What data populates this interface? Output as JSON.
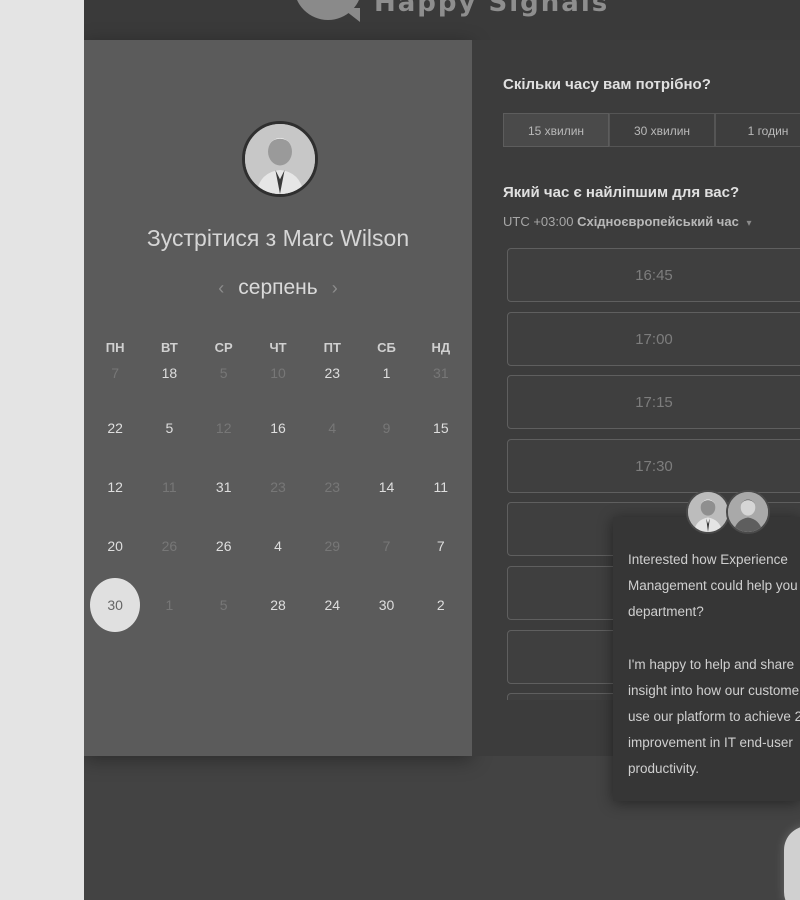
{
  "brand": {
    "wordmark": "Happy Signals"
  },
  "left": {
    "title": "Зустрітися з Marc Wilson",
    "month": "серпень",
    "prev_label": "‹",
    "next_label": "›",
    "weekdays": [
      "ПН",
      "ВТ",
      "СР",
      "ЧТ",
      "ПТ",
      "СБ",
      "НД"
    ],
    "weeks": [
      [
        "7",
        "18",
        "5",
        "10",
        "23",
        "1",
        "31"
      ],
      [
        "22",
        "5",
        "12",
        "16",
        "4",
        "9",
        "15"
      ],
      [
        "12",
        "11",
        "31",
        "23",
        "23",
        "14",
        "11"
      ],
      [
        "20",
        "26",
        "26",
        "4",
        "29",
        "7",
        "7"
      ],
      [
        "30",
        "1",
        "5",
        "28",
        "24",
        "30",
        "2"
      ]
    ]
  },
  "right": {
    "duration_question": "Скільки часу вам потрібно?",
    "durations": [
      "15 хвилин",
      "30 хвилин",
      "1 годин"
    ],
    "time_question": "Який час є найліпшим для вас?",
    "tz_offset": "UTC +03:00",
    "tz_name": "Східноєвропейський час",
    "tz_caret": "▾",
    "slots": [
      "16:45",
      "17:00",
      "17:15",
      "17:30",
      "",
      "",
      "",
      ""
    ]
  },
  "popup": {
    "line1": "Interested how Experience",
    "line2": "Management could help you",
    "line3": "department?",
    "line4": "I'm happy to help and share",
    "line5": "insight into how our custome",
    "line6": "use our platform to achieve 2",
    "line7": "improvement in IT end-user",
    "line8": "productivity."
  }
}
